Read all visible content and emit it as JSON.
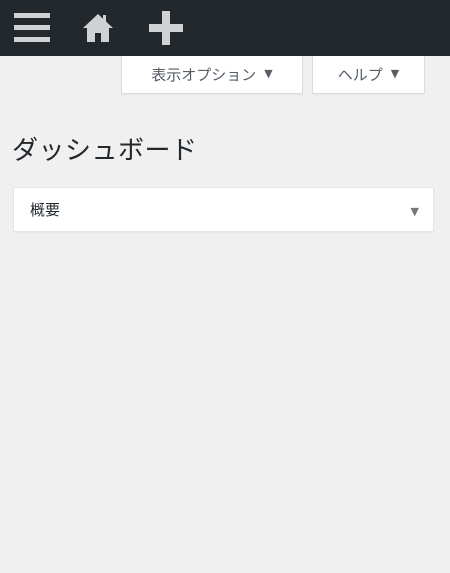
{
  "admin_bar": {
    "menu_icon": "menu-icon",
    "home_icon": "home-icon",
    "add_icon": "plus-icon"
  },
  "screen_meta": {
    "options_label": "表示オプション",
    "help_label": "ヘルプ",
    "arrow": "▼"
  },
  "page": {
    "title": "ダッシュボード"
  },
  "postbox": {
    "title": "概要",
    "toggle": "▼"
  },
  "colors": {
    "admin_bar_bg": "#23282d",
    "page_bg": "#f0f0f0",
    "icon": "#cfd2d4"
  }
}
